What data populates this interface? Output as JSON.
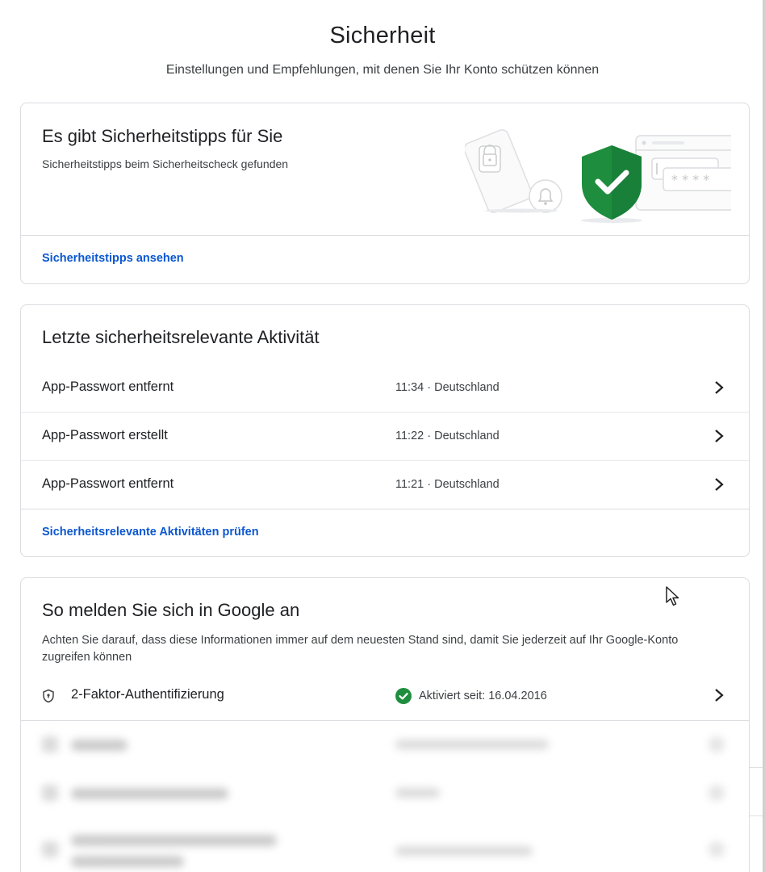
{
  "page": {
    "title": "Sicherheit",
    "subtitle": "Einstellungen und Empfehlungen, mit denen Sie Ihr Konto schützen können"
  },
  "tips_card": {
    "title": "Es gibt Sicherheitstipps für Sie",
    "description": "Sicherheitstipps beim Sicherheitscheck gefunden",
    "link": "Sicherheitstipps ansehen",
    "illustration_icons": [
      "phone-lock-icon",
      "bell-icon",
      "shield-check-icon",
      "password-window-icon"
    ],
    "password_mask": "* * * *"
  },
  "activity_card": {
    "title": "Letzte sicherheitsrelevante Aktivität",
    "rows": [
      {
        "label": "App-Passwort entfernt",
        "meta": "11:34 · Deutschland"
      },
      {
        "label": "App-Passwort erstellt",
        "meta": "11:22 · Deutschland"
      },
      {
        "label": "App-Passwort entfernt",
        "meta": "11:21 · Deutschland"
      }
    ],
    "link": "Sicherheitsrelevante Aktivitäten prüfen"
  },
  "signin_card": {
    "title": "So melden Sie sich in Google an",
    "description": "Achten Sie darauf, dass diese Informationen immer auf dem neuesten Stand sind, damit Sie jederzeit auf Ihr Google-Konto zugreifen können",
    "tfa": {
      "label": "2-Faktor-Authentifizierung",
      "status": "Aktiviert seit: 16.04.2016"
    }
  },
  "colors": {
    "accent_link": "#0b57d0",
    "shield_green": "#1e8e3e",
    "border": "#dadce0",
    "text_primary": "#202124",
    "text_secondary": "#3c4043"
  }
}
